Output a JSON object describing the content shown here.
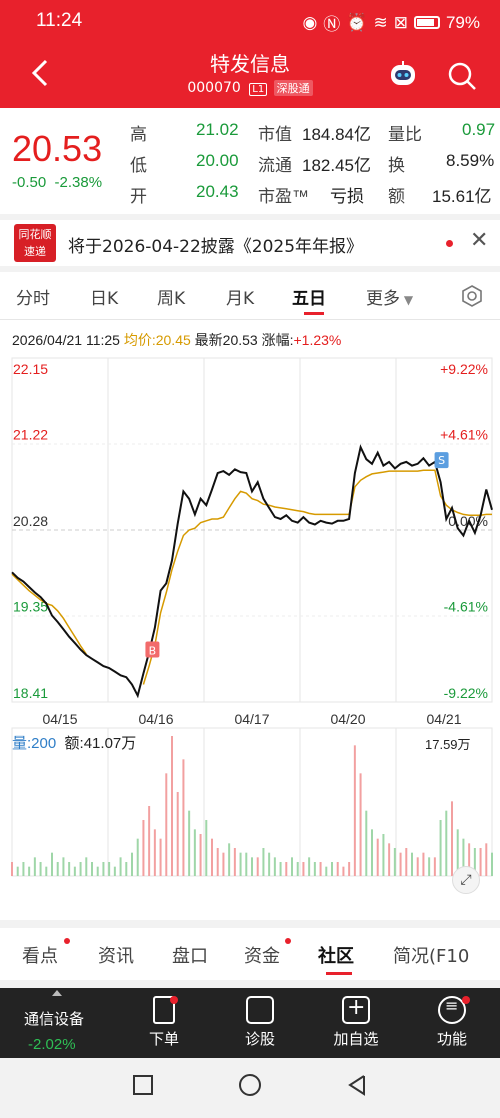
{
  "status": {
    "time": "11:24",
    "battery": "79%"
  },
  "header": {
    "title": "特发信息",
    "code": "000070",
    "level_tag": "L1",
    "market_tag": "深股通"
  },
  "quote": {
    "price": "20.53",
    "change": "-0.50",
    "change_pct": "-2.38%",
    "high_label": "高",
    "high": "21.02",
    "low_label": "低",
    "low": "20.00",
    "open_label": "开",
    "open": "20.43",
    "mcap_label": "市值",
    "mcap": "184.84亿",
    "float_label": "流通",
    "float": "182.45亿",
    "pe_label": "市盈™",
    "pe": "亏损",
    "ratio_label": "量比",
    "ratio": "0.97",
    "turnover_label": "换",
    "turnover": "8.59%",
    "amount_label": "额",
    "amount": "15.61亿"
  },
  "notice": {
    "logo_line1": "同花顺",
    "logo_line2": "速递",
    "text": "将于2026-04-22披露《2025年年报》"
  },
  "tabs": [
    "分时",
    "日K",
    "周K",
    "月K",
    "五日",
    "更多"
  ],
  "chart_info": {
    "datetime": "2026/04/21 11:25",
    "avg": "均价:20.45",
    "latest": "最新20.53",
    "change": "涨幅:+1.23%"
  },
  "volume_info": {
    "vol": "量:200",
    "amount": "额:41.07万",
    "max": "17.59万"
  },
  "chart_data": {
    "type": "line",
    "title": "",
    "x_labels": [
      "04/15",
      "04/16",
      "04/17",
      "04/20",
      "04/21"
    ],
    "y_labels_left": [
      "22.15",
      "21.22",
      "20.28",
      "19.35",
      "18.41"
    ],
    "y_labels_right": [
      "+9.22%",
      "+4.61%",
      "0.00%",
      "-4.61%",
      "-9.22%"
    ],
    "ylim": [
      18.41,
      22.15
    ],
    "series": [
      {
        "name": "",
        "values": [
          19.82,
          19.76,
          19.72,
          19.66,
          19.6,
          19.55,
          19.48,
          19.35,
          19.28,
          19.2,
          19.12,
          19.05,
          18.98,
          18.92,
          18.88,
          18.84,
          18.8,
          18.78,
          18.74,
          18.7,
          18.68,
          18.6,
          18.48,
          18.72,
          18.95,
          19.22,
          19.62,
          19.7,
          19.95,
          20.35,
          20.7,
          20.62,
          20.45,
          20.62,
          20.55,
          20.72,
          20.9,
          20.92,
          20.88,
          20.94,
          20.91,
          20.9,
          20.7,
          20.8,
          20.62,
          20.52,
          20.42,
          20.4,
          20.44,
          20.38,
          20.36,
          20.42,
          20.36,
          20.34,
          20.38,
          20.36,
          20.35,
          20.38,
          20.38,
          20.4,
          20.9,
          21.18,
          21.05,
          21.0,
          21.12,
          20.98,
          21.02,
          20.95,
          21.0,
          21.02,
          20.98,
          21.0,
          21.06,
          20.98,
          21.02,
          20.8,
          20.4,
          20.52,
          20.3,
          20.22,
          20.38,
          20.25,
          20.44,
          20.72,
          20.5
        ]
      },
      {
        "name": "",
        "values": [
          19.8,
          19.74,
          19.68,
          19.62,
          19.57,
          19.52,
          19.48,
          19.46,
          19.4,
          19.32,
          19.22,
          19.12,
          19.02,
          18.93,
          null,
          null,
          null,
          null,
          null,
          null,
          null,
          null,
          null,
          18.6,
          18.8,
          19.03,
          19.38,
          19.6,
          19.85,
          20.05,
          20.22,
          20.28,
          20.3,
          20.36,
          20.38,
          20.4,
          20.4,
          20.42,
          20.52,
          20.62,
          20.7,
          20.68,
          20.62,
          20.6,
          20.56,
          20.55,
          20.53,
          20.52,
          20.51,
          20.5,
          20.49,
          20.48,
          20.46,
          20.45,
          20.45,
          20.45,
          20.45,
          20.45,
          20.45,
          20.45,
          20.75,
          20.82,
          20.86,
          20.89,
          20.9,
          20.91,
          20.92,
          20.92,
          20.92,
          20.92,
          20.92,
          20.92,
          20.93,
          20.93,
          20.93,
          20.65,
          20.55,
          20.5,
          20.47,
          20.45,
          20.44,
          20.44,
          20.44,
          20.45,
          20.45
        ]
      }
    ],
    "markers": [
      "B",
      "S"
    ],
    "volume": [
      3,
      2,
      3,
      2,
      4,
      3,
      2,
      5,
      3,
      4,
      3,
      2,
      3,
      4,
      3,
      2,
      3,
      3,
      2,
      4,
      3,
      5,
      8,
      12,
      15,
      10,
      8,
      22,
      30,
      18,
      25,
      14,
      10,
      9,
      12,
      8,
      6,
      5,
      7,
      6,
      5,
      5,
      4,
      4,
      6,
      5,
      4,
      3,
      3,
      4,
      3,
      3,
      4,
      3,
      3,
      2,
      3,
      3,
      2,
      3,
      28,
      22,
      14,
      10,
      8,
      9,
      7,
      6,
      5,
      6,
      5,
      4,
      5,
      4,
      4,
      12,
      14,
      16,
      10,
      8,
      7,
      6,
      6,
      7,
      5
    ]
  },
  "lower_tabs": [
    "看点",
    "资讯",
    "盘口",
    "资金",
    "社区",
    "简况(F10"
  ],
  "bottom_bar": {
    "sector": "通信设备",
    "sector_change": "-2.02%",
    "order": "下单",
    "diagnose": "诊股",
    "add_watch": "加自选",
    "functions": "功能"
  },
  "colors": {
    "brand": "#e8212c",
    "up": "#e41e1e",
    "down": "#1a9a3a",
    "avg_line": "#d69a00"
  }
}
